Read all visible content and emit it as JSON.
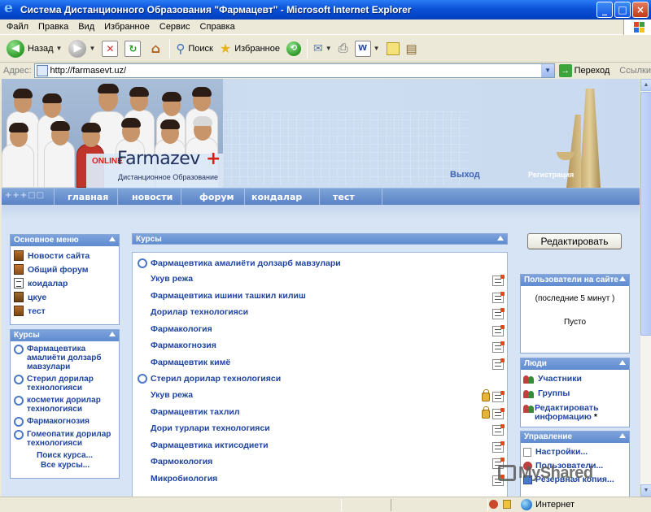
{
  "window": {
    "title": "Система Дистанционного Образования \"Фармацевт\" - Microsoft Internet Explorer",
    "min": "_",
    "max": "□",
    "close": "×"
  },
  "menu": [
    "Файл",
    "Правка",
    "Вид",
    "Избранное",
    "Сервис",
    "Справка"
  ],
  "toolbar": {
    "back": "Назад",
    "search": "Поиск",
    "favorites": "Избранное"
  },
  "address": {
    "label": "Адрес:",
    "url": "http://farmasevt.uz/",
    "go": "Переход",
    "links": "Ссылки"
  },
  "banner": {
    "logo_online": "ONLINE",
    "logo_main": "Farmazev",
    "logo_plus": "+",
    "logo_sub": "Дистанционное Образование",
    "exit": "Выход",
    "register": "Регистрация"
  },
  "nav": {
    "glyphs": "+++□□",
    "items": [
      "главная",
      "новости",
      "форум",
      "кондалар",
      "тест"
    ]
  },
  "main_menu": {
    "title": "Основное меню",
    "items": [
      "Новости сайта",
      "Общий форум",
      "коидалар",
      "цкуе",
      "тест"
    ]
  },
  "courses_block": {
    "title": "Курсы",
    "items": [
      "Фармацевтика амалиёти долзарб мавзулари",
      "Стерил дорилар технологияси",
      "косметик дорилар технологияси",
      "Фармакогнозия",
      "Гомеопатик дорилар технологияси"
    ],
    "search": "Поиск курса...",
    "all": "Все курсы..."
  },
  "center": {
    "title": "Курсы",
    "course1": {
      "title": "Фармацевтика амалиёти долзарб мавзулари",
      "items": [
        "Укув режа",
        "Фармацевтика ишини ташкил килиш",
        "Дорилар технологияси",
        "Фармакология",
        "Фармакогнозия",
        "Фармацевтик кимё"
      ]
    },
    "course2": {
      "title": "Стерил дорилар технологияси",
      "items": [
        "Укув режа",
        "Фармацевтик тахлил",
        "Дори турлари технологияси",
        "Фармацевтика иктисодиети",
        "Фармокология",
        "Микробиология"
      ]
    }
  },
  "edit_button": "Редактировать",
  "users_block": {
    "title": "Пользователи на сайте",
    "period": "(последние 5 минут )",
    "empty": "Пусто"
  },
  "people_block": {
    "title": "Люди",
    "items": [
      "Участники",
      "Группы",
      "Редактировать информацию"
    ],
    "asterisk": "*"
  },
  "admin_block": {
    "title": "Управление",
    "items": [
      "Настройки...",
      "Пользователи...",
      "Резервная копия..."
    ]
  },
  "watermark": "MyShared",
  "status": {
    "zone": "Интернет"
  }
}
